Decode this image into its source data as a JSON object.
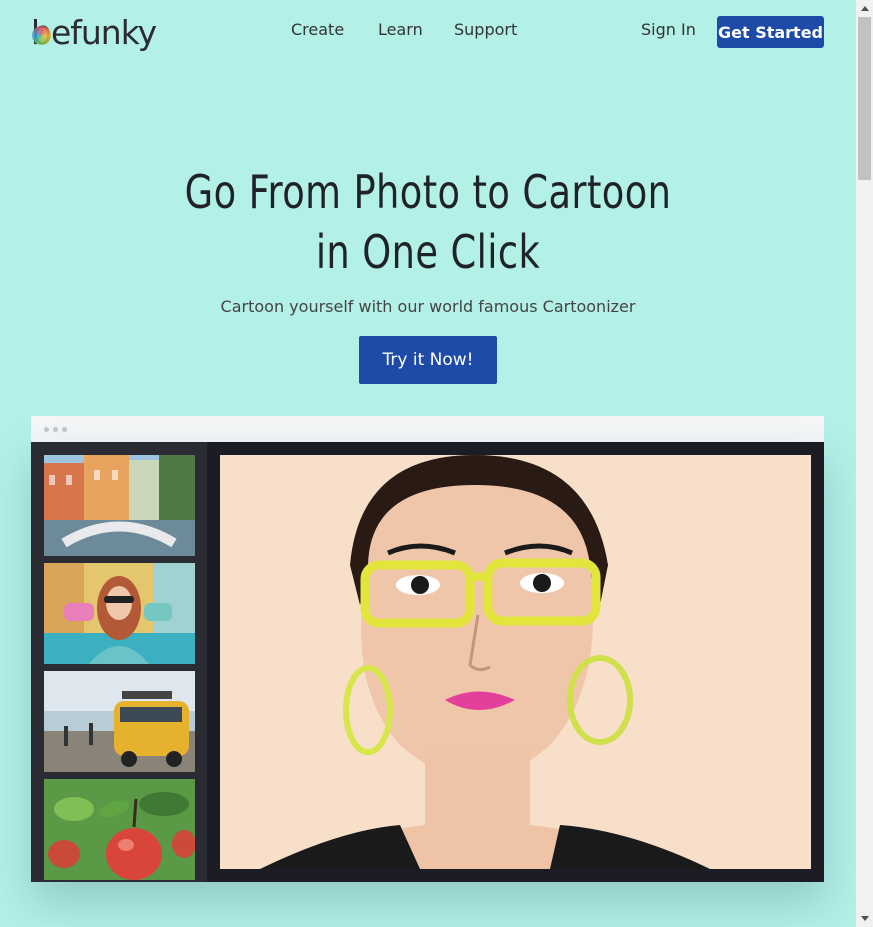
{
  "header": {
    "logo_text": "befunky",
    "nav": [
      "Create",
      "Learn",
      "Support"
    ],
    "sign_in": "Sign In",
    "get_started": "Get Started"
  },
  "hero": {
    "title_line1": "Go From Photo to Cartoon",
    "title_line2": "in One Click",
    "subtitle": "Cartoon yourself with our world famous Cartoonizer",
    "cta": "Try it Now!"
  },
  "editor": {
    "thumbnails": [
      "city-canal-thumbnail",
      "woman-skateboard-thumbnail",
      "yellow-van-thumbnail",
      "apples-thumbnail"
    ],
    "main_image": "cartoon-woman-glasses"
  },
  "colors": {
    "background": "#b3f0e8",
    "accent": "#1e4aa8",
    "editor_bg": "#1c1d24"
  }
}
